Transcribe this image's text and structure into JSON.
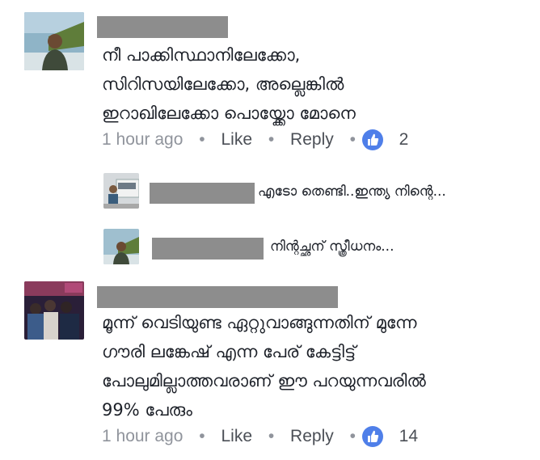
{
  "comments": [
    {
      "text_lines": [
        "നീ പാക്കിസ്ഥാനിലേക്കോ,",
        "സിറിസയിലേക്കോ, അല്ലെങ്കിൽ",
        "ഇറാഖിലേക്കോ പൊയ്ക്കോ മോനെ"
      ],
      "time": "1 hour ago",
      "like_label": "Like",
      "reply_label": "Reply",
      "reaction_icon": "like-icon",
      "reaction_count": "2"
    },
    {
      "text_lines": [
        "മൂന്ന് വെടിയുണ്ട ഏറ്റുവാങ്ങുന്നതിന് മുന്നേ",
        "ഗൗരി ലങ്കേഷ് എന്ന പേര് കേട്ടിട്ട്",
        "പോലുമില്ലാത്തവരാണ് ഈ പറയുന്നവരിൽ",
        "99% പേരും"
      ],
      "time": "1 hour ago",
      "like_label": "Like",
      "reply_label": "Reply",
      "reaction_icon": "like-icon",
      "reaction_count": "14"
    }
  ],
  "replies": [
    {
      "text": "എടോ തെണ്ടി..ഇന്ത്യ നിന്റെ..."
    },
    {
      "text": "നിന്റച്ഛന് സ്ത്രീധനം..."
    }
  ],
  "meta_separator": "•",
  "colors": {
    "like_blue": "#4f7fe9",
    "meta_gray": "#90949c",
    "link_gray": "#4b4f56",
    "redaction": "#8d8d8d"
  }
}
